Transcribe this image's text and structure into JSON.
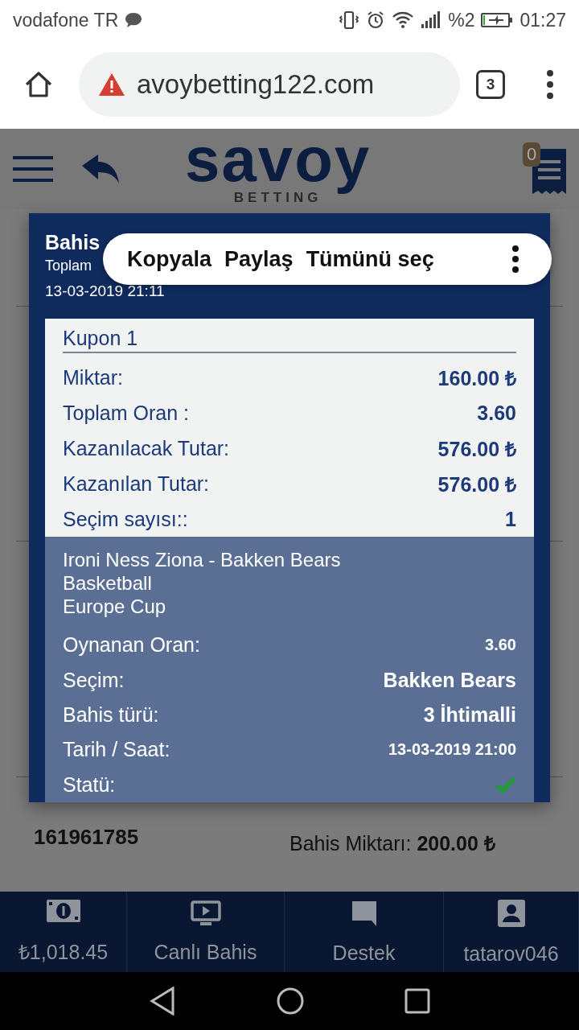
{
  "status_bar": {
    "carrier": "vodafone TR",
    "battery": "%2",
    "time": "01:27"
  },
  "browser": {
    "url": "avoybetting122.com",
    "tab_count": "3"
  },
  "header": {
    "logo_text": "savoy",
    "logo_subtext": "BETTING",
    "betslip_count": "0"
  },
  "background": {
    "bet_number": "161961785",
    "stake_label": "Bahis Miktarı:",
    "stake_value": "200.00 ₺"
  },
  "modal": {
    "title": "Bahis",
    "subtitle": "Toplam",
    "date": "13-03-2019 21:11",
    "context_menu": {
      "items": [
        "Kopyala",
        "Paylaş",
        "Tümünü seç"
      ]
    },
    "coupon": {
      "title": "Kupon 1",
      "rows": [
        {
          "label": "Miktar:",
          "value": "160.00 ₺"
        },
        {
          "label": "Toplam Oran :",
          "value": "3.60"
        },
        {
          "label": "Kazanılacak Tutar:",
          "value": "576.00 ₺"
        },
        {
          "label": "Kazanılan Tutar:",
          "value": "576.00 ₺"
        },
        {
          "label": "Seçim sayısı::",
          "value": "1"
        }
      ]
    },
    "selection": {
      "lines": [
        "Ironi Ness Ziona - Bakken Bears",
        "Basketball",
        "Europe Cup"
      ],
      "rows": [
        {
          "kind": "small",
          "label": "Oynanan Oran:",
          "value": "3.60"
        },
        {
          "kind": "text",
          "label": "Seçim:",
          "value": "Bakken Bears"
        },
        {
          "kind": "text",
          "label": "Bahis türü:",
          "value": "3 İhtimalli"
        },
        {
          "kind": "small",
          "label": "Tarih / Saat:",
          "value": "13-03-2019 21:00"
        },
        {
          "kind": "status",
          "label": "Statü:",
          "won": true
        }
      ]
    }
  },
  "bottom_nav": [
    {
      "kind": "money",
      "label": "₺1,018.45"
    },
    {
      "kind": "tv",
      "label": "Canlı Bahis"
    },
    {
      "kind": "chat",
      "label": "Destek"
    },
    {
      "kind": "person",
      "label": "tatarov046"
    }
  ]
}
